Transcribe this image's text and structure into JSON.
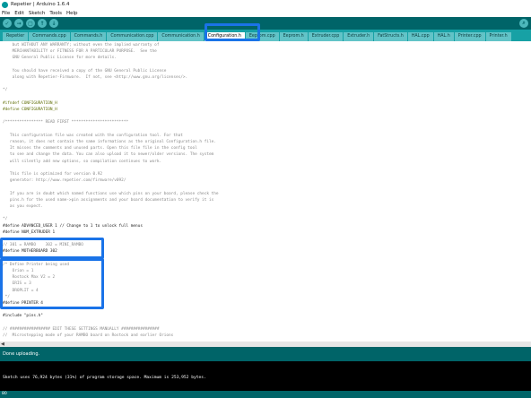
{
  "window": {
    "title": "Repetier | Arduino 1.6.4"
  },
  "menu": [
    "File",
    "Edit",
    "Sketch",
    "Tools",
    "Help"
  ],
  "toolbar": {
    "verify": "✓",
    "upload": "→",
    "new": "▢",
    "open": "↑",
    "save": "↓",
    "serial_monitor": "⌕"
  },
  "tabs": [
    "Repetier",
    "Commands.cpp",
    "Commands.h",
    "Communication.cpp",
    "Communication.h",
    "Configuration.h",
    "Eeprom.cpp",
    "Eeprom.h",
    "Extruder.cpp",
    "Extruder.h",
    "FatStructs.h",
    "HAL.cpp",
    "HAL.h",
    "Printer.cpp",
    "Printer.h"
  ],
  "active_tab": "Configuration.h",
  "code": [
    {
      "t": "    but WITHOUT ANY WARRANTY; without even the implied warranty of",
      "c": "c-comment"
    },
    {
      "t": "    MERCHANTABILITY or FITNESS FOR A PARTICULAR PURPOSE.  See the",
      "c": "c-comment"
    },
    {
      "t": "    GNU General Public License for more details.",
      "c": "c-comment"
    },
    {
      "t": "",
      "c": ""
    },
    {
      "t": "    You should have received a copy of the GNU General Public License",
      "c": "c-comment"
    },
    {
      "t": "    along with Repetier-Firmware.  If not, see <http://www.gnu.org/licenses/>.",
      "c": "c-comment"
    },
    {
      "t": "",
      "c": ""
    },
    {
      "t": "*/",
      "c": "c-comment"
    },
    {
      "t": "",
      "c": ""
    },
    {
      "t": "#ifndef CONFIGURATION_H",
      "c": "c-dir"
    },
    {
      "t": "#define CONFIGURATION_H",
      "c": "c-dir"
    },
    {
      "t": "",
      "c": ""
    },
    {
      "t": "/**************** READ FIRST ************************",
      "c": "c-comment"
    },
    {
      "t": "",
      "c": ""
    },
    {
      "t": "   This configuration file was created with the configuration tool. For that",
      "c": "c-comment"
    },
    {
      "t": "   reason, it does not contain the same informations as the original Configuration.h file.",
      "c": "c-comment"
    },
    {
      "t": "   It misses the comments and unused parts. Open this file file in the config tool",
      "c": "c-comment"
    },
    {
      "t": "   to see and change the data. You can also upload it to newer/older versions. The system",
      "c": "c-comment"
    },
    {
      "t": "   will silently add new options, so compilation continues to work.",
      "c": "c-comment"
    },
    {
      "t": "",
      "c": ""
    },
    {
      "t": "   This file is optimized for version 0.92",
      "c": "c-comment"
    },
    {
      "t": "   generator: http://www.repetier.com/firmware/v092/",
      "c": "c-comment"
    },
    {
      "t": "",
      "c": ""
    },
    {
      "t": "   If you are in doubt which named functions use which pins on your board, please check the",
      "c": "c-comment"
    },
    {
      "t": "   pins.h for the used name->pin assignments and your board documentation to verify it is",
      "c": "c-comment"
    },
    {
      "t": "   as you expect.",
      "c": "c-comment"
    },
    {
      "t": "",
      "c": ""
    },
    {
      "t": "*/",
      "c": "c-comment"
    },
    {
      "t": "#define ADVANCED_USER 1 // Change to 1 to unlock full menus",
      "c": ""
    },
    {
      "t": "#define NUM_EXTRUDER 1",
      "c": ""
    },
    {
      "t": "",
      "c": ""
    },
    {
      "t": "// 301 = RAMBO    302 = MINI_RAMBO",
      "c": "c-comment"
    },
    {
      "t": "#define MOTHERBOARD 302",
      "c": ""
    },
    {
      "t": "",
      "c": ""
    },
    {
      "t": "/* Define Printer being used",
      "c": "c-comment"
    },
    {
      "t": "    Orion = 1",
      "c": "c-comment"
    },
    {
      "t": "    Rostock Max V2 = 2",
      "c": "c-comment"
    },
    {
      "t": "    ERIS = 3",
      "c": "c-comment"
    },
    {
      "t": "    DROPLIT = 4",
      "c": "c-comment"
    },
    {
      "t": " */",
      "c": "c-comment"
    },
    {
      "t": "#define PRINTER 4",
      "c": ""
    },
    {
      "t": "",
      "c": ""
    },
    {
      "t": "#include \"pins.h\"",
      "c": ""
    },
    {
      "t": "",
      "c": ""
    },
    {
      "t": "// ################# EDIT THESE SETTINGS MANUALLY ################",
      "c": "c-comment"
    },
    {
      "t": "//  Microstepping mode of your RAMBO board on Rostock and earlier Orions",
      "c": "c-comment"
    }
  ],
  "status": {
    "message": "Done uploading."
  },
  "console": {
    "output": "Sketch uses 76,924 bytes (31%) of program storage space. Maximum is 253,952 bytes."
  },
  "footer": {
    "line_number": "80"
  }
}
